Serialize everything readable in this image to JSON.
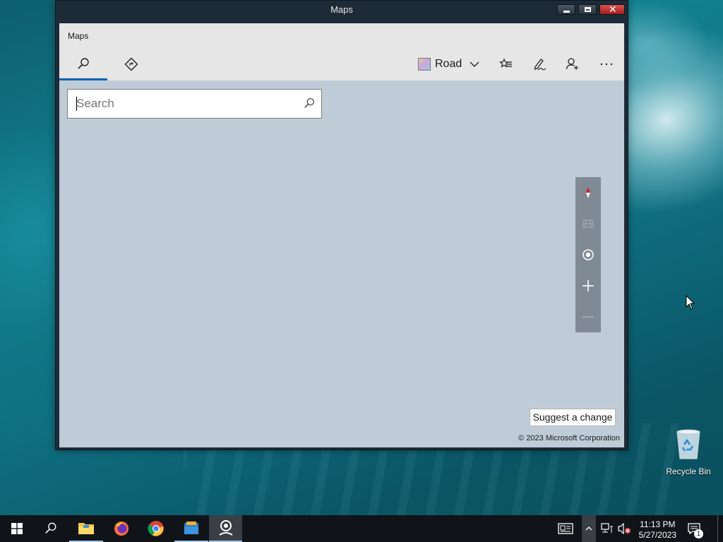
{
  "window": {
    "title": "Maps"
  },
  "app": {
    "title": "Maps",
    "tabs": [
      {
        "icon": "search-icon"
      },
      {
        "icon": "directions-icon"
      }
    ],
    "toolbar": {
      "map_style_label": "Road",
      "icons": [
        "favorites-icon",
        "ink-pen-icon",
        "account-icon",
        "more-icon"
      ]
    },
    "search": {
      "placeholder": "Search",
      "value": ""
    },
    "map_controls": [
      "compass-icon",
      "tilt-icon",
      "locate-icon",
      "zoom-in-icon",
      "zoom-out-icon"
    ],
    "suggest_label": "Suggest a change",
    "copyright": "© 2023 Microsoft Corporation"
  },
  "desktop": {
    "recycle_bin_label": "Recycle Bin"
  },
  "taskbar": {
    "apps": [
      "start",
      "search",
      "file-explorer",
      "firefox",
      "chrome",
      "files",
      "maps"
    ],
    "clock": {
      "time": "11:13 PM",
      "date": "5/27/2023"
    },
    "notifications_count": "1"
  },
  "colors": {
    "accent": "#0063b1",
    "map_bg": "#bfccd8",
    "titlebar": "#1d2b38",
    "close_red": "#c0302b"
  }
}
